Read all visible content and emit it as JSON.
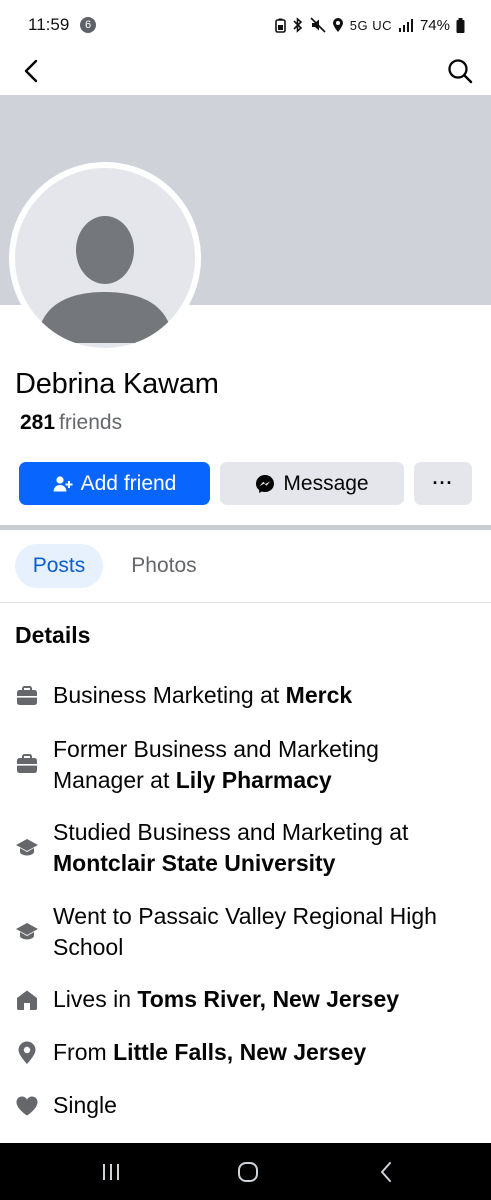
{
  "status_bar": {
    "time": "11:59",
    "notification_count": "6",
    "network": "5G UC",
    "battery": "74%"
  },
  "profile": {
    "name": "Debrina Kawam",
    "friends_count": "281",
    "friends_label": "friends"
  },
  "actions": {
    "add_friend": "Add friend",
    "message": "Message",
    "more": "···"
  },
  "tabs": [
    {
      "label": "Posts",
      "active": true
    },
    {
      "label": "Photos",
      "active": false
    }
  ],
  "details": {
    "title": "Details",
    "items": [
      {
        "icon": "briefcase-icon",
        "pre": "Business Marketing at ",
        "bold": "Merck",
        "post": ""
      },
      {
        "icon": "briefcase-icon",
        "pre": "Former Business and Marketing Manager at ",
        "bold": "Lily Pharmacy",
        "post": ""
      },
      {
        "icon": "graduation-cap-icon",
        "pre": "Studied Business and Marketing at ",
        "bold": "Montclair State University",
        "post": ""
      },
      {
        "icon": "graduation-cap-icon",
        "pre": "Went to Passaic Valley Regional High School",
        "bold": "",
        "post": ""
      },
      {
        "icon": "home-icon",
        "pre": "Lives in ",
        "bold": "Toms River, New Jersey",
        "post": ""
      },
      {
        "icon": "location-pin-icon",
        "pre": "From ",
        "bold": "Little Falls, New Jersey",
        "post": ""
      },
      {
        "icon": "heart-icon",
        "pre": "Single",
        "bold": "",
        "post": ""
      }
    ]
  },
  "colors": {
    "accent": "#0866ff",
    "cover": "#cfd3d9",
    "secondary_button": "#e4e6eb",
    "icon_gray": "#65676b"
  }
}
